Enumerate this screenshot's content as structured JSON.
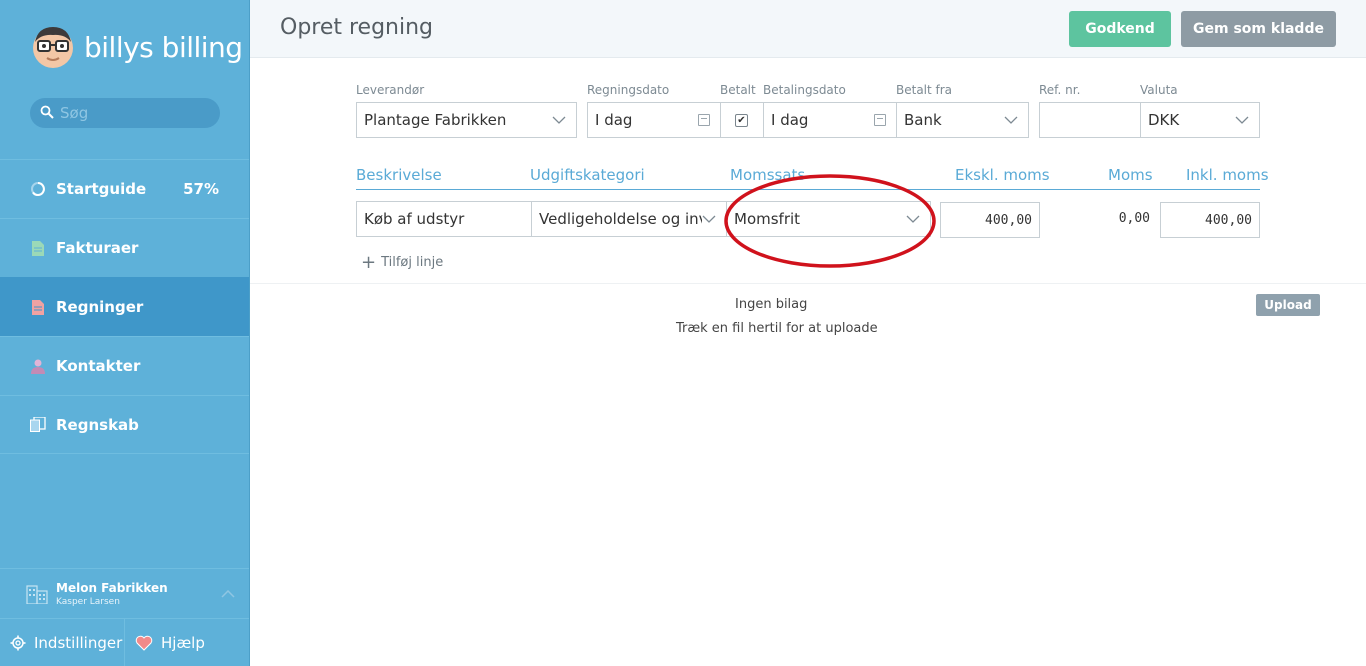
{
  "sidebar": {
    "logo_text": "billys billing",
    "search_placeholder": "Søg",
    "items": [
      {
        "label": "Startguide",
        "icon": "progress-ring-icon",
        "pct": "57%"
      },
      {
        "label": "Fakturaer",
        "icon": "invoice-doc-icon"
      },
      {
        "label": "Regninger",
        "icon": "bill-doc-icon",
        "active": true
      },
      {
        "label": "Kontakter",
        "icon": "person-icon"
      },
      {
        "label": "Regnskab",
        "icon": "ledger-icon"
      }
    ],
    "company_name": "Melon Fabrikken",
    "company_user": "Kasper Larsen",
    "settings_label": "Indstillinger",
    "help_label": "Hjælp"
  },
  "header": {
    "title": "Opret regning",
    "approve_label": "Godkend",
    "draft_label": "Gem som kladde"
  },
  "form": {
    "supplier": {
      "label": "Leverandør",
      "value": "Plantage Fabrikken"
    },
    "bill_date": {
      "label": "Regningsdato",
      "value": "I dag"
    },
    "paid": {
      "label": "Betalt",
      "checked": true
    },
    "pay_date": {
      "label": "Betalingsdato",
      "value": "I dag"
    },
    "paid_from": {
      "label": "Betalt fra",
      "value": "Bank"
    },
    "ref": {
      "label": "Ref. nr.",
      "value": ""
    },
    "currency": {
      "label": "Valuta",
      "value": "DKK"
    }
  },
  "lines": {
    "headers": {
      "description": "Beskrivelse",
      "category": "Udgiftskategori",
      "vat_rate": "Momssats",
      "excl": "Ekskl. moms",
      "vat": "Moms",
      "incl": "Inkl. moms"
    },
    "rows": [
      {
        "description": "Køb af udstyr",
        "category": "Vedligeholdelse og inve",
        "vat_rate": "Momsfrit",
        "excl": "400,00",
        "vat": "0,00",
        "incl": "400,00"
      }
    ],
    "add_label": "Tilføj linje"
  },
  "attachments": {
    "none_label": "Ingen bilag",
    "drag_label": "Træk en fil hertil for at uploade",
    "upload_label": "Upload"
  },
  "colors": {
    "sidebar": "#5eb1d9",
    "active_nav": "#3f97c9",
    "approve": "#5dc49f",
    "draft": "#8e9ba4",
    "annotation": "#d0121c"
  }
}
